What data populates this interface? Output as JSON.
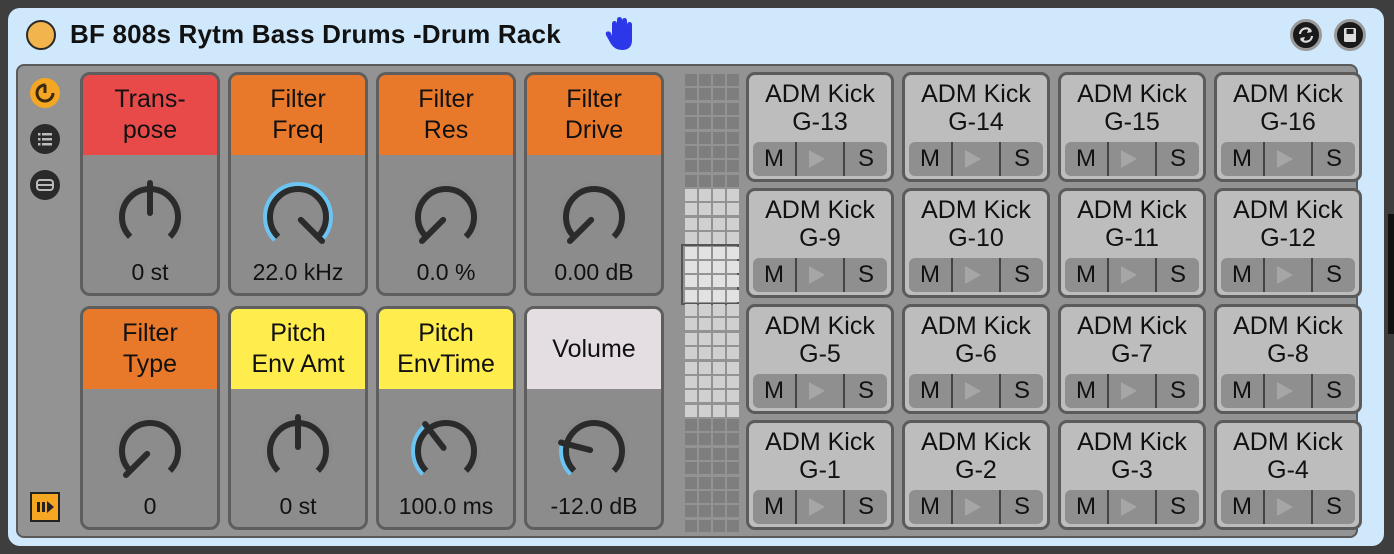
{
  "device": {
    "title": "BF 808s Rytm Bass Drums -Drum Rack",
    "accent": "#f2b44c",
    "background": "#cfe8fb"
  },
  "icons": {
    "power": "device-on-off",
    "hand": "hand-icon",
    "hotswap": "hotswap-icon",
    "save": "save-icon",
    "macro_toggle": "macro-knobs-icon",
    "chain_list": "chain-list-icon",
    "io": "input-output-icon",
    "sequencer": "sequencer-icon"
  },
  "colors": {
    "red": "#e84a4a",
    "orange": "#e8782a",
    "yellow": "#ffec4d",
    "light": "#e4dde2",
    "knob_arc": "#6cc4f2",
    "knob_track": "#8a8a8a"
  },
  "macros": [
    {
      "label": "Trans-\npose",
      "value": "0 st",
      "color": "red",
      "level": 0.5,
      "bipolar": true
    },
    {
      "label": "Filter\nFreq",
      "value": "22.0 kHz",
      "color": "orange",
      "level": 1.0,
      "bipolar": false
    },
    {
      "label": "Filter\nRes",
      "value": "0.0 %",
      "color": "orange",
      "level": 0.0,
      "bipolar": false
    },
    {
      "label": "Filter\nDrive",
      "value": "0.00 dB",
      "color": "orange",
      "level": 0.0,
      "bipolar": false
    },
    {
      "label": "Filter\nType",
      "value": "0",
      "color": "orange",
      "level": 0.0,
      "bipolar": false
    },
    {
      "label": "Pitch\nEnv Amt",
      "value": "0 st",
      "color": "yellow",
      "level": 0.5,
      "bipolar": true
    },
    {
      "label": "Pitch\nEnvTime",
      "value": "100.0 ms",
      "color": "yellow",
      "level": 0.36,
      "bipolar": false
    },
    {
      "label": "Volume",
      "value": "-12.0 dB",
      "color": "light",
      "level": 0.22,
      "bipolar": false
    }
  ],
  "pads": [
    {
      "name": "ADM Kick\nG-13"
    },
    {
      "name": "ADM Kick\nG-14"
    },
    {
      "name": "ADM Kick\nG-15"
    },
    {
      "name": "ADM Kick\nG-16"
    },
    {
      "name": "ADM Kick\nG-9"
    },
    {
      "name": "ADM Kick\nG-10"
    },
    {
      "name": "ADM Kick\nG-11"
    },
    {
      "name": "ADM Kick\nG-12"
    },
    {
      "name": "ADM Kick\nG-5"
    },
    {
      "name": "ADM Kick\nG-6"
    },
    {
      "name": "ADM Kick\nG-7"
    },
    {
      "name": "ADM Kick\nG-8"
    },
    {
      "name": "ADM Kick\nG-1"
    },
    {
      "name": "ADM Kick\nG-2"
    },
    {
      "name": "ADM Kick\nG-3"
    },
    {
      "name": "ADM Kick\nG-4"
    }
  ],
  "pad_buttons": {
    "mute": "M",
    "solo": "S"
  },
  "pad_overview": {
    "rows": 32,
    "cols": 4,
    "selected_bank_rows": [
      12,
      16
    ]
  }
}
